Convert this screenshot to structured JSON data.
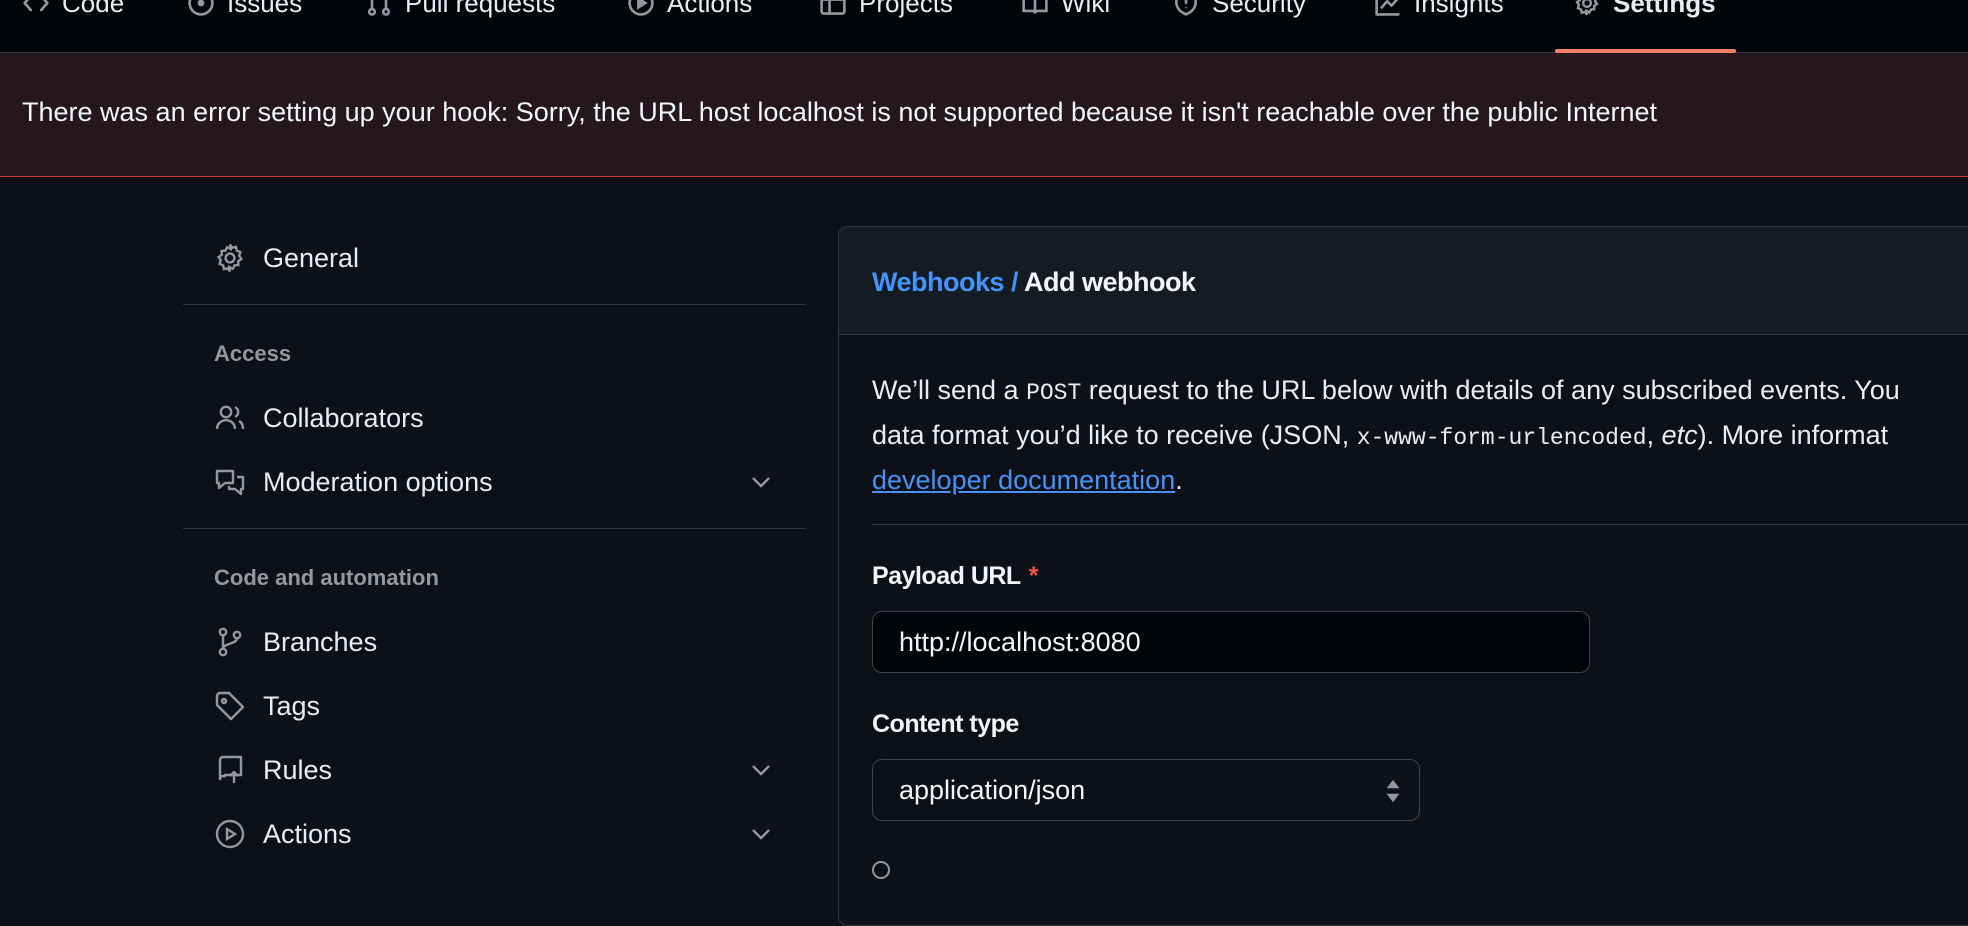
{
  "repo_nav": {
    "tabs": [
      {
        "label": "Code",
        "icon": "code-icon"
      },
      {
        "label": "Issues",
        "icon": "issue-icon"
      },
      {
        "label": "Pull requests",
        "icon": "pull-request-icon"
      },
      {
        "label": "Actions",
        "icon": "play-icon"
      },
      {
        "label": "Projects",
        "icon": "table-icon"
      },
      {
        "label": "Wiki",
        "icon": "book-icon"
      },
      {
        "label": "Security",
        "icon": "shield-icon"
      },
      {
        "label": "Insights",
        "icon": "graph-icon"
      },
      {
        "label": "Settings",
        "icon": "gear-icon",
        "active": true
      }
    ],
    "accent_color": "#f78166"
  },
  "flash": {
    "message": "There was an error setting up your hook: Sorry, the URL host localhost is not supported because it isn't reachable over the public Internet",
    "border_color": "#c93c37"
  },
  "sidebar": {
    "general": {
      "label": "General",
      "icon": "gear-icon"
    },
    "sections": [
      {
        "heading": "Access",
        "items": [
          {
            "label": "Collaborators",
            "icon": "people-icon"
          },
          {
            "label": "Moderation options",
            "icon": "comment-discussion-icon",
            "expandable": true
          }
        ]
      },
      {
        "heading": "Code and automation",
        "items": [
          {
            "label": "Branches",
            "icon": "git-branch-icon"
          },
          {
            "label": "Tags",
            "icon": "tag-icon"
          },
          {
            "label": "Rules",
            "icon": "repo-push-icon",
            "expandable": true
          },
          {
            "label": "Actions",
            "icon": "play-icon",
            "expandable": true
          }
        ]
      }
    ]
  },
  "main": {
    "breadcrumb": {
      "parent": "Webhooks",
      "separator": "/",
      "current": "Add webhook"
    },
    "description": {
      "line1_a": "We’ll send a ",
      "line1_code": "POST",
      "line1_b": " request to the URL below with details of any subscribed events. You",
      "line2_a": "data format you’d like to receive (JSON, ",
      "line2_code": "x-www-form-urlencoded",
      "line2_b": ", ",
      "line2_em": "etc",
      "line2_c": "). More informat",
      "link": "developer documentation",
      "link_suffix": "."
    },
    "payload_url": {
      "label": "Payload URL",
      "required_mark": "*",
      "value": "http://localhost:8080"
    },
    "content_type": {
      "label": "Content type",
      "selected": "application/json"
    },
    "link_color": "#4493f8"
  }
}
